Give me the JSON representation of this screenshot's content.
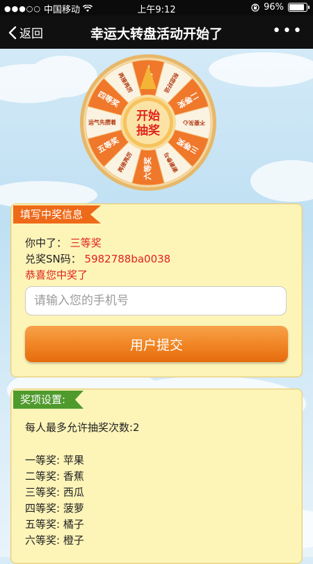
{
  "status_bar": {
    "carrier": "中国移动",
    "time": "上午9:12",
    "battery": "96%",
    "battery_level": 0.96
  },
  "nav": {
    "back_label": "返回",
    "title": "幸运大转盘活动开始了",
    "more_label": "•••"
  },
  "wheel": {
    "center_line1": "开始",
    "center_line2": "抽奖",
    "segments": [
      "一等奖",
      "祝您好运",
      "二等奖",
      "不要灰心",
      "三等奖",
      "谢谢参与",
      "六等奖",
      "再接再厉",
      "五等奖",
      "运气先攒着",
      "四等奖",
      "再接再厉"
    ],
    "colors": {
      "orange": "#f0782a",
      "light": "#fbf3e2",
      "rim": "#f2c88a"
    }
  },
  "win_card": {
    "tag": "填写中奖信息",
    "win_label": "你中了：",
    "win_value": "三等奖",
    "sn_label": "兑奖SN码：",
    "sn_value": "5982788ba0038",
    "congrats": "恭喜您中奖了",
    "phone_placeholder": "请输入您的手机号",
    "submit_label": "用户提交"
  },
  "prize_card": {
    "tag": "奖项设置:",
    "max_draws": "每人最多允许抽奖次数:2",
    "prizes": [
      "一等奖: 苹果",
      "二等奖: 香蕉",
      "三等奖: 西瓜",
      "四等奖: 菠萝",
      "五等奖: 橘子",
      "六等奖: 橙子"
    ]
  },
  "colors": {
    "tag_orange": "#ee6a19",
    "tag_green": "#4f9a2d",
    "highlight_red": "#e0231b",
    "card_bg": "#fdf4b8"
  }
}
